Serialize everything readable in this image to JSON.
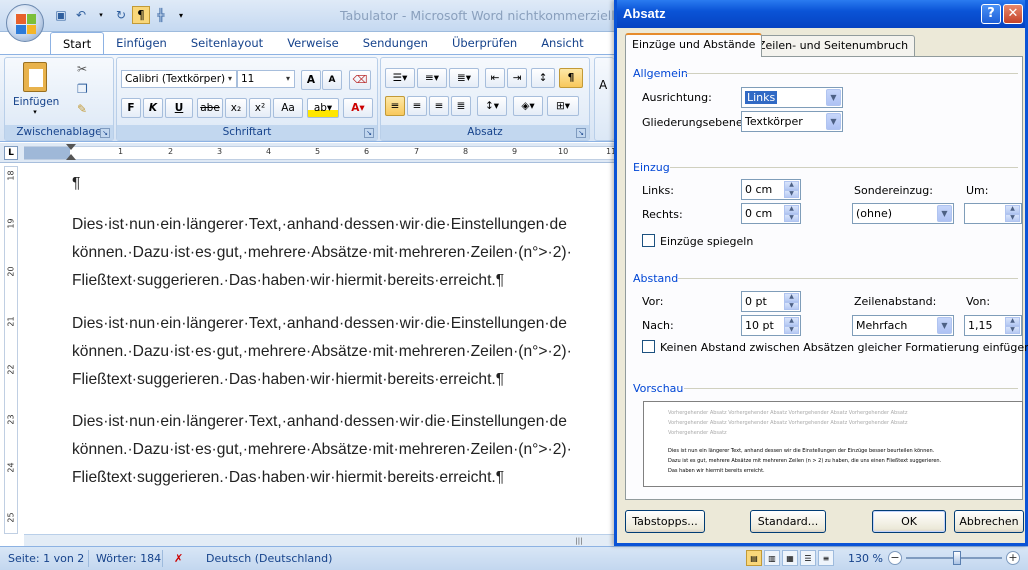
{
  "window": {
    "title": "Tabulator - Microsoft Word nichtkommerzielle"
  },
  "quick_access": {
    "items": [
      "save-icon",
      "undo-icon",
      "undo-dropdown",
      "redo-icon",
      "pilcrow-icon",
      "table-icon",
      "customize-icon"
    ]
  },
  "ribbon": {
    "tabs": [
      "Start",
      "Einfügen",
      "Seitenlayout",
      "Verweise",
      "Sendungen",
      "Überprüfen",
      "Ansicht"
    ],
    "active_tab": "Start",
    "clipboard": {
      "label": "Zwischenablage",
      "paste": "Einfügen"
    },
    "font": {
      "label": "Schriftart",
      "family": "Calibri (Textkörper)",
      "size": "11",
      "bold": "F",
      "italic": "K",
      "underline": "U",
      "strike": "abe",
      "sub": "x₂",
      "sup": "x²",
      "case": "Aa",
      "grow": "A",
      "shrink": "A"
    },
    "paragraph": {
      "label": "Absatz",
      "pilcrow": "¶"
    },
    "styles": {
      "label": "A"
    }
  },
  "ruler": {
    "corner": "L",
    "numbers": [
      "1",
      "2",
      "3",
      "4",
      "5",
      "6",
      "7",
      "8",
      "9",
      "10",
      "11"
    ]
  },
  "vruler": {
    "numbers": [
      "18",
      "19",
      "20",
      "21",
      "22",
      "23",
      "24",
      "25"
    ]
  },
  "document": {
    "empty_mark": "¶",
    "paragraphs": [
      {
        "line1": "Dies·ist·nun·ein·längerer·Text,·anhand·dessen·wir·die·Einstellungen·de",
        "line2": "können.·Dazu·ist·es·gut,·mehrere·Absätze·mit·mehreren·Zeilen·(n°>·2)·",
        "line3": "Fließtext·suggerieren.·Das·haben·wir·hiermit·bereits·erreicht.¶"
      },
      {
        "line1": "Dies·ist·nun·ein·längerer·Text,·anhand·dessen·wir·die·Einstellungen·de",
        "line2": "können.·Dazu·ist·es·gut,·mehrere·Absätze·mit·mehreren·Zeilen·(n°>·2)·",
        "line3": "Fließtext·suggerieren.·Das·haben·wir·hiermit·bereits·erreicht.¶"
      },
      {
        "line1": "Dies·ist·nun·ein·längerer·Text,·anhand·dessen·wir·die·Einstellungen·de",
        "line2": "können.·Dazu·ist·es·gut,·mehrere·Absätze·mit·mehreren·Zeilen·(n°>·2)·",
        "line3": "Fließtext·suggerieren.·Das·haben·wir·hiermit·bereits·erreicht.¶"
      }
    ]
  },
  "statusbar": {
    "page": "Seite: 1 von 2",
    "words": "Wörter: 184",
    "language": "Deutsch (Deutschland)",
    "zoom": "130 %"
  },
  "dialog": {
    "title": "Absatz",
    "help": "?",
    "close": "✕",
    "tabs": [
      "Einzüge und Abstände",
      "Zeilen- und Seitenumbruch"
    ],
    "active_tab": "Einzüge und Abstände",
    "allgemein": {
      "title": "Allgemein",
      "alignment_label": "Ausrichtung:",
      "alignment_value": "Links",
      "outline_label": "Gliederungsebene:",
      "outline_value": "Textkörper"
    },
    "einzug": {
      "title": "Einzug",
      "left_label": "Links:",
      "left_value": "0 cm",
      "right_label": "Rechts:",
      "right_value": "0 cm",
      "special_label": "Sondereinzug:",
      "special_value": "(ohne)",
      "by_label": "Um:",
      "by_value": "",
      "mirror_label": "Einzüge spiegeln"
    },
    "abstand": {
      "title": "Abstand",
      "before_label": "Vor:",
      "before_value": "0 pt",
      "after_label": "Nach:",
      "after_value": "10 pt",
      "line_label": "Zeilenabstand:",
      "line_value": "Mehrfach",
      "at_label": "Von:",
      "at_value": "1,15",
      "no_space_label": "Keinen Abstand zwischen Absätzen gleicher Formatierung einfügen"
    },
    "preview": {
      "title": "Vorschau",
      "prev_lines": [
        "Vorhergehender Absatz Vorhergehender Absatz Vorhergehender Absatz Vorhergehender Absatz",
        "Vorhergehender Absatz Vorhergehender Absatz Vorhergehender Absatz Vorhergehender Absatz",
        "Vorhergehender Absatz"
      ],
      "sample_lines": [
        "Dies ist nun ein längerer Text, anhand dessen wir die Einstellungen der Einzüge besser beurteilen können.",
        "Dazu ist es gut, mehrere Absätze mit mehreren Zeilen (n > 2) zu haben, die uns einen Fließtext suggerieren.",
        "Das haben wir hiermit bereits erreicht."
      ]
    },
    "buttons": {
      "tabs": "Tabstopps...",
      "default": "Standard...",
      "ok": "OK",
      "cancel": "Abbrechen"
    }
  }
}
